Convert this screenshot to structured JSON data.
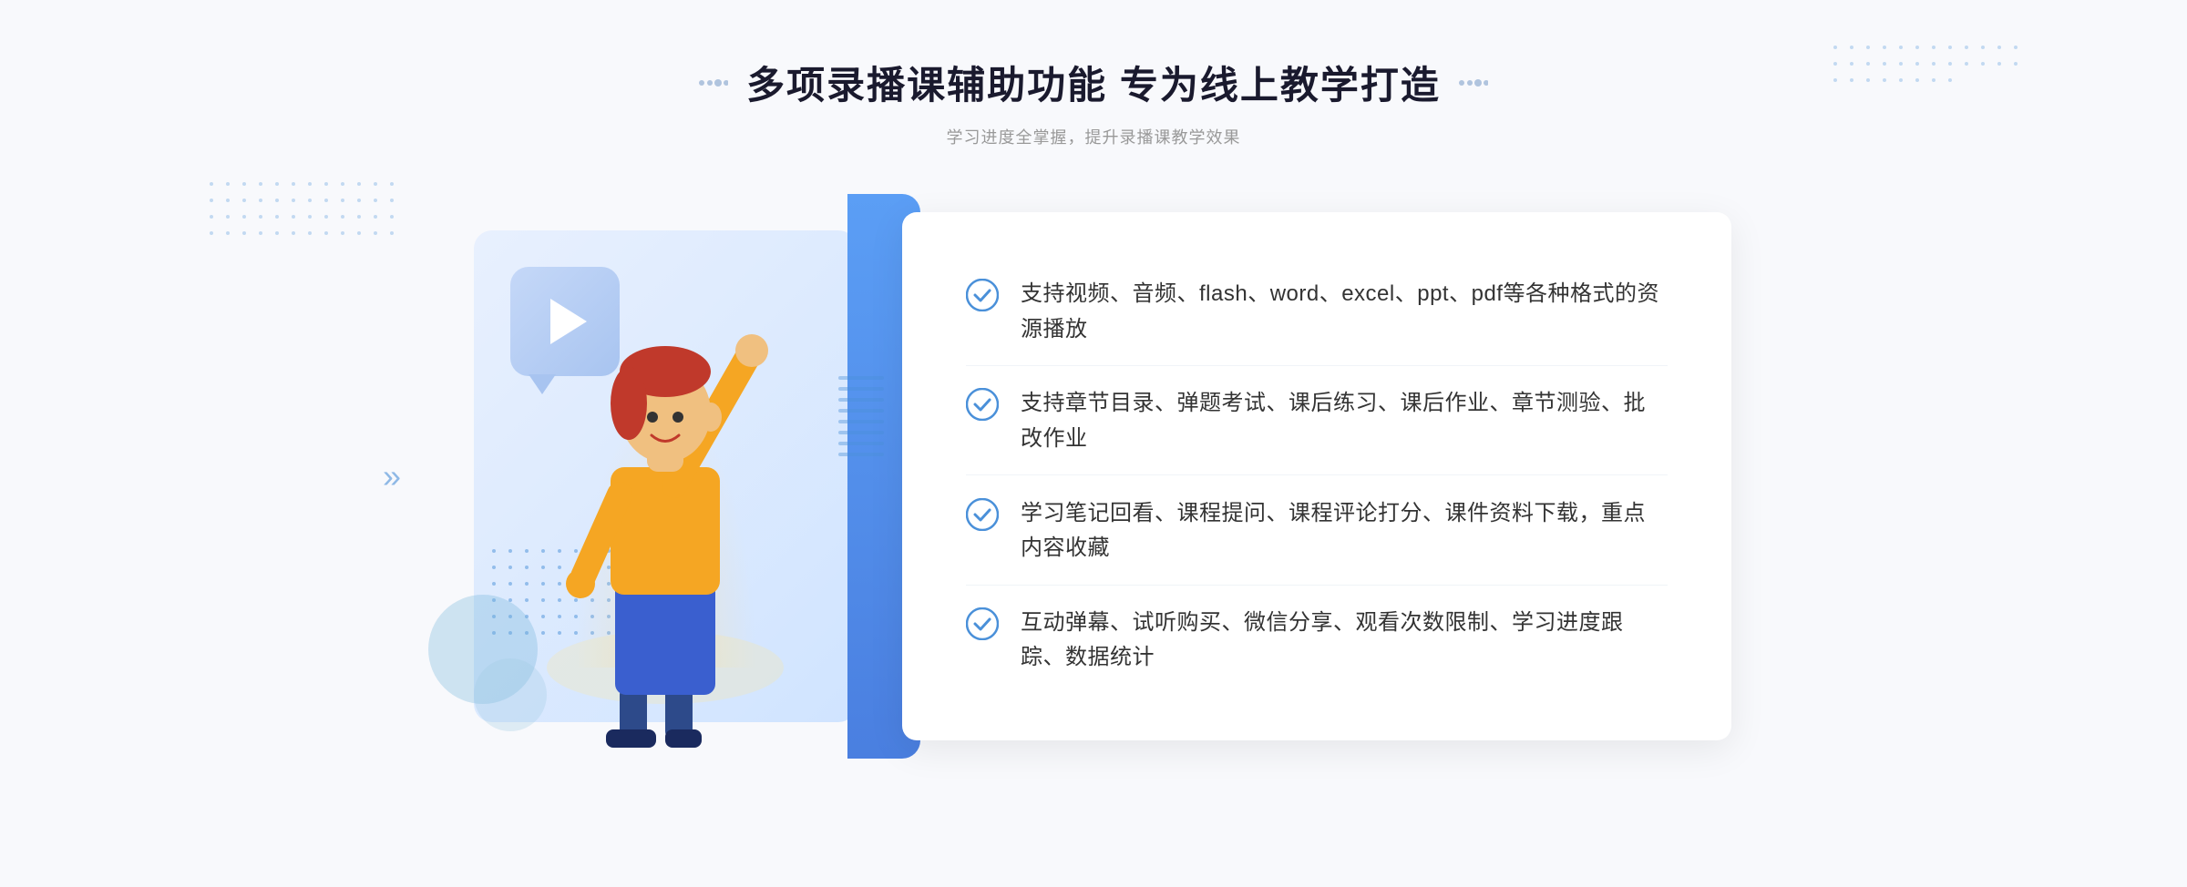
{
  "header": {
    "main_title": "多项录播课辅助功能 专为线上教学打造",
    "subtitle": "学习进度全掌握，提升录播课教学效果"
  },
  "features": [
    {
      "id": 1,
      "text": "支持视频、音频、flash、word、excel、ppt、pdf等各种格式的资源播放"
    },
    {
      "id": 2,
      "text": "支持章节目录、弹题考试、课后练习、课后作业、章节测验、批改作业"
    },
    {
      "id": 3,
      "text": "学习笔记回看、课程提问、课程评论打分、课件资料下载，重点内容收藏"
    },
    {
      "id": 4,
      "text": "互动弹幕、试听购买、微信分享、观看次数限制、学习进度跟踪、数据统计"
    }
  ],
  "colors": {
    "accent_blue": "#4a7fe0",
    "light_blue": "#6baed6",
    "text_dark": "#1a1a2e",
    "text_gray": "#999999",
    "check_color": "#4a90d9"
  }
}
